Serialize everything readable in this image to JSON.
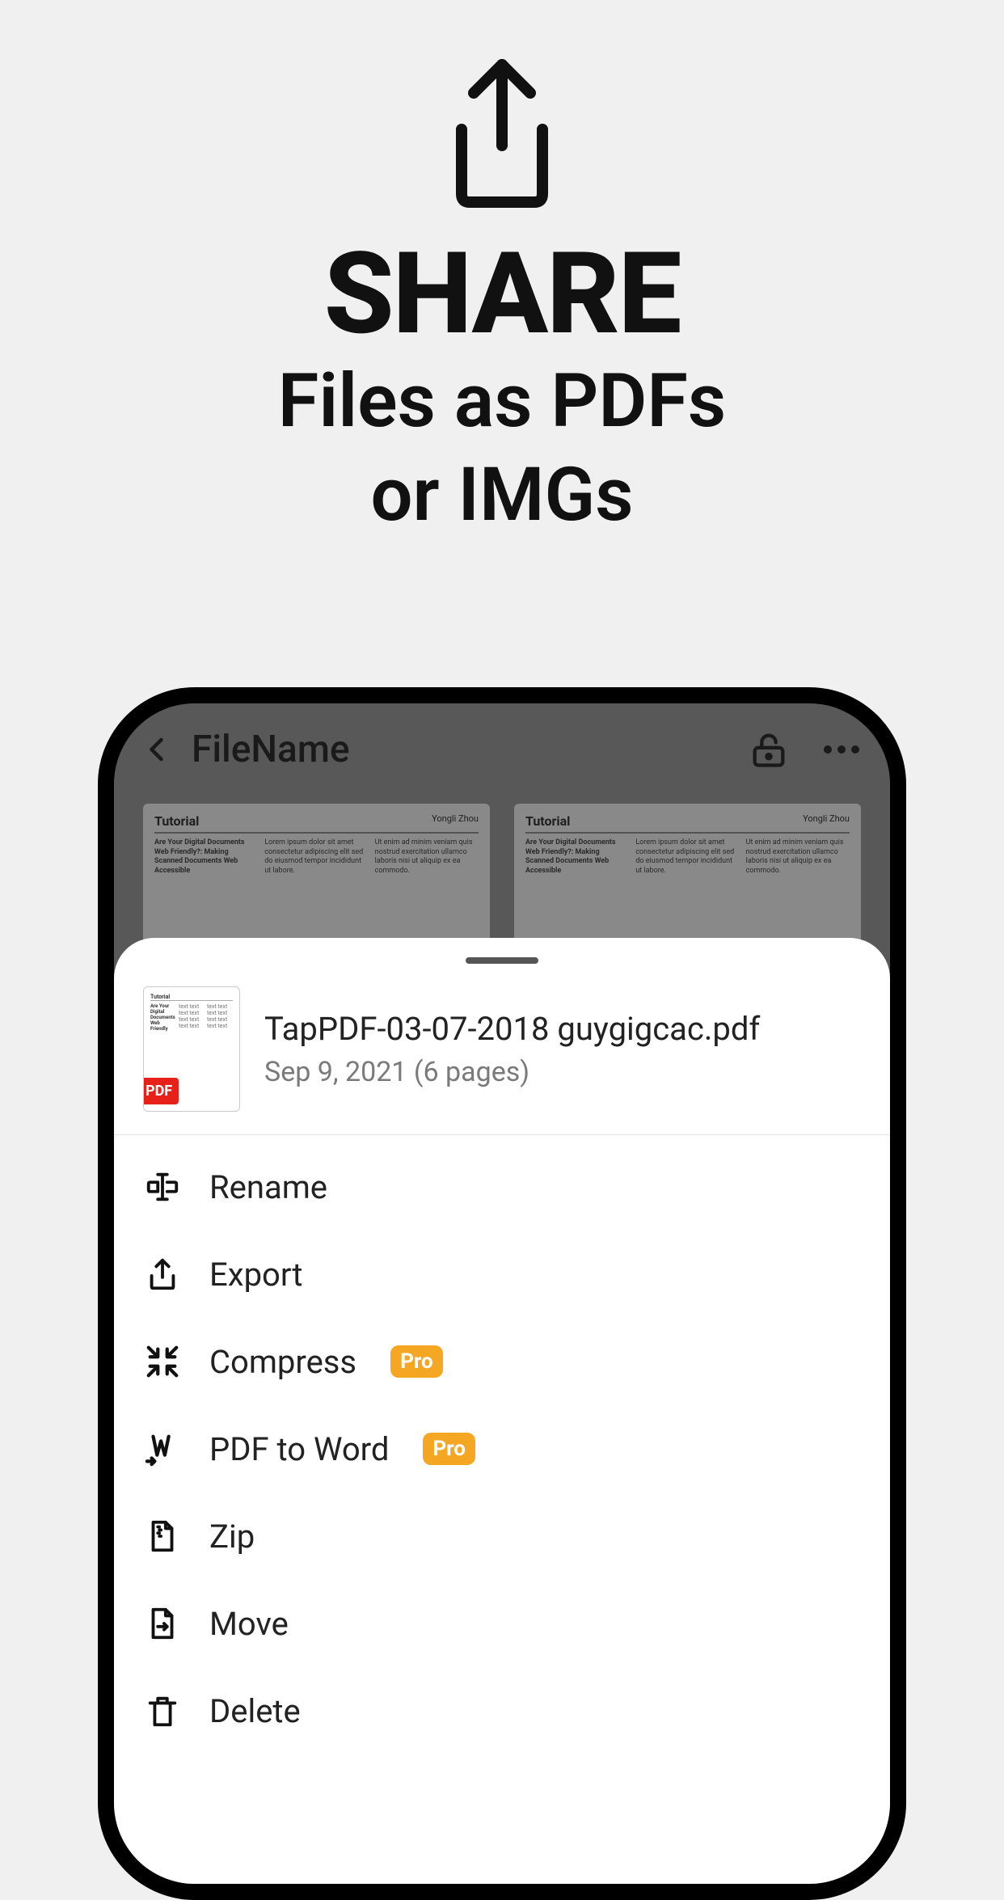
{
  "promo": {
    "headline": "SHARE",
    "subline1": "Files as PDFs",
    "subline2": "or IMGs"
  },
  "app": {
    "header_title": "FileName",
    "doc_preview": {
      "label": "Tutorial",
      "author": "Yongli Zhou",
      "heading": "Are Your Digital Documents Web Friendly?: Making Scanned Documents Web Accessible"
    }
  },
  "sheet": {
    "file_name": "TapPDF-03-07-2018 guygigcac.pdf",
    "file_meta": "Sep 9, 2021 (6 pages)",
    "pdf_badge": "PDF",
    "pro_badge": "Pro",
    "actions": {
      "rename": "Rename",
      "export": "Export",
      "compress": "Compress",
      "pdf_to_word": "PDF to Word",
      "zip": "Zip",
      "move": "Move",
      "delete": "Delete"
    }
  }
}
